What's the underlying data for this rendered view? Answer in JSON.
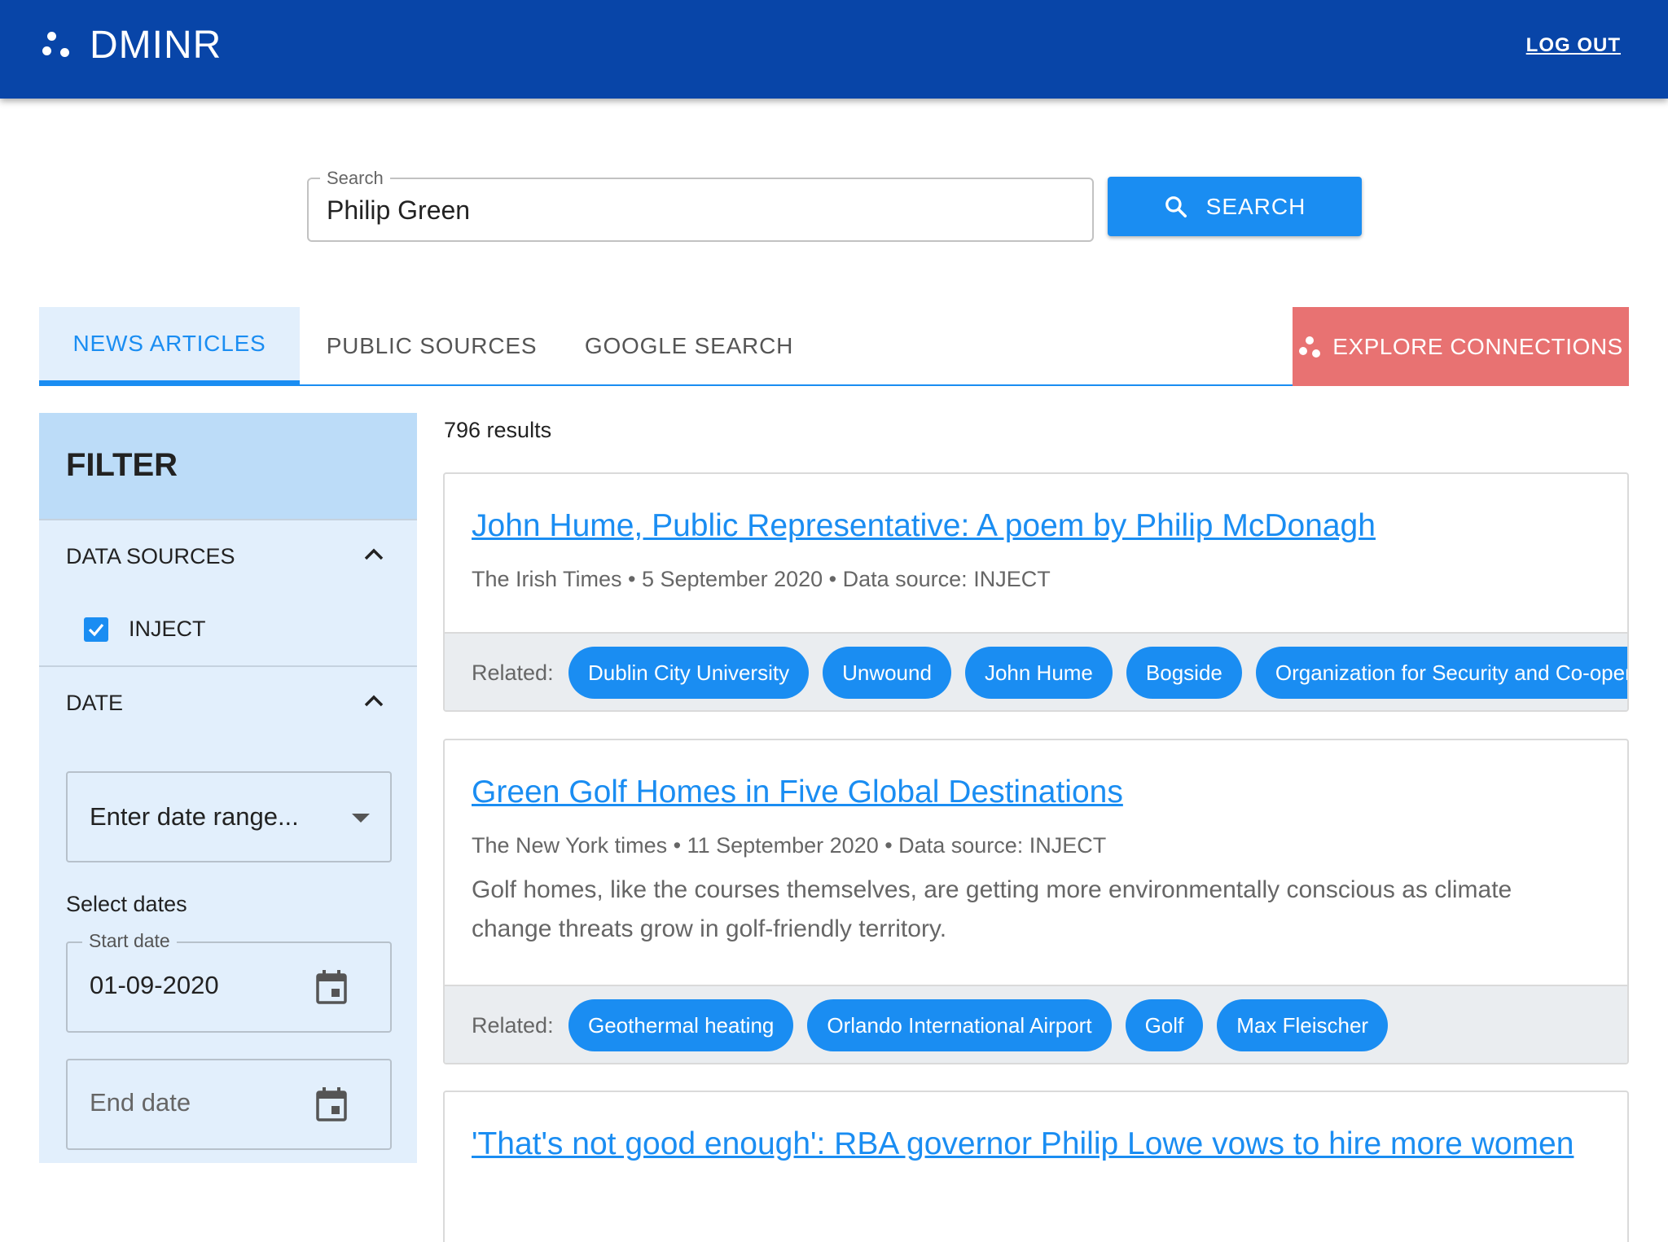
{
  "app": {
    "title": "DMINR",
    "logout_label": "LOG OUT"
  },
  "search": {
    "legend": "Search",
    "value": "Philip Green",
    "button_label": "SEARCH"
  },
  "tabs": [
    {
      "label": "NEWS ARTICLES",
      "active": true
    },
    {
      "label": "PUBLIC SOURCES",
      "active": false
    },
    {
      "label": "GOOGLE SEARCH",
      "active": false
    }
  ],
  "explore_label": "EXPLORE CONNECTIONS",
  "filter": {
    "title": "FILTER",
    "data_sources": {
      "label": "DATA SOURCES",
      "options": [
        {
          "label": "INJECT",
          "checked": true
        }
      ]
    },
    "date": {
      "label": "DATE",
      "range_placeholder": "Enter date range...",
      "select_dates_label": "Select dates",
      "start": {
        "legend": "Start date",
        "value": "01-09-2020"
      },
      "end": {
        "placeholder": "End date"
      }
    }
  },
  "results": {
    "count_label": "796 results",
    "articles": [
      {
        "title": "John Hume, Public Representative: A poem by Philip McDonagh",
        "meta": "The Irish Times • 5 September 2020 • Data source: INJECT",
        "description": "",
        "related_label": "Related:",
        "related": [
          "Dublin City University",
          "Unwound",
          "John Hume",
          "Bogside",
          "Organization for Security and Co-operation in Europe"
        ]
      },
      {
        "title": "Green Golf Homes in Five Global Destinations",
        "meta": "The New York times • 11 September 2020 • Data source: INJECT",
        "description": "Golf homes, like the courses themselves, are getting more environmentally conscious as climate change threats grow in golf-friendly territory.",
        "related_label": "Related:",
        "related": [
          "Geothermal heating",
          "Orlando International Airport",
          "Golf",
          "Max Fleischer"
        ]
      },
      {
        "title": "'That's not good enough': RBA governor Philip Lowe vows to hire more women",
        "meta": "",
        "description": "",
        "related_label": "",
        "related": []
      }
    ]
  },
  "colors": {
    "header": "#0845a8",
    "accent": "#1a8df2",
    "explore": "#e87272",
    "filter_bg": "#e2effc",
    "filter_head": "#bcdcf8"
  },
  "icons": {
    "brand": "dots-logo-icon",
    "search": "search-icon",
    "chevron": "chevron-up-icon",
    "checkbox": "check-icon",
    "calendar": "calendar-icon",
    "caret": "caret-down-icon"
  }
}
